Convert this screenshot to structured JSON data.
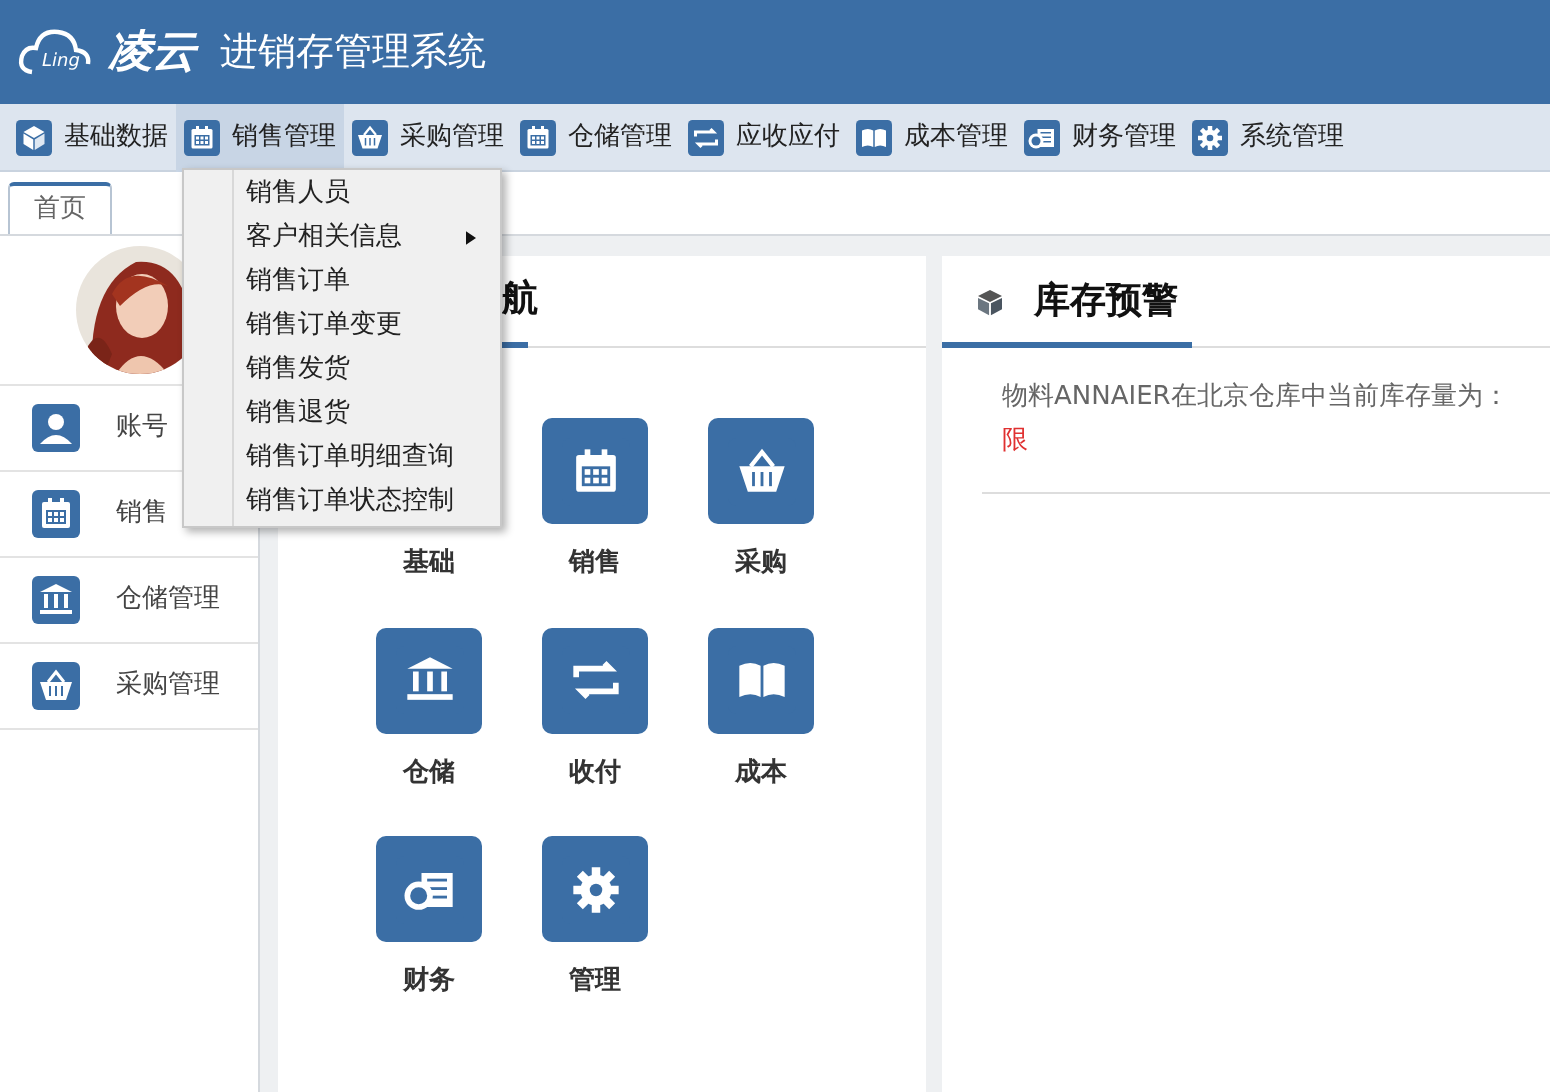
{
  "header": {
    "logo_text": "Ling",
    "brand": "凌云",
    "title": "进销存管理系统"
  },
  "nav": [
    {
      "label": "基础数据",
      "selected": false
    },
    {
      "label": "销售管理",
      "selected": true
    },
    {
      "label": "采购管理",
      "selected": false
    },
    {
      "label": "仓储管理",
      "selected": false
    },
    {
      "label": "应收应付",
      "selected": false
    },
    {
      "label": "成本管理",
      "selected": false
    },
    {
      "label": "财务管理",
      "selected": false
    },
    {
      "label": "系统管理",
      "selected": false
    }
  ],
  "tabs": [
    {
      "label": "首页",
      "selected": true
    }
  ],
  "dropdown": [
    {
      "label": "销售人员",
      "submenu": false
    },
    {
      "label": "客户相关信息",
      "submenu": true
    },
    {
      "label": "销售订单",
      "submenu": false
    },
    {
      "label": "销售订单变更",
      "submenu": false
    },
    {
      "label": "销售发货",
      "submenu": false
    },
    {
      "label": "销售退货",
      "submenu": false
    },
    {
      "label": "销售订单明细查询",
      "submenu": false
    },
    {
      "label": "销售订单状态控制",
      "submenu": false
    }
  ],
  "sidebar": {
    "items": [
      {
        "label": "账号"
      },
      {
        "label": "销售"
      },
      {
        "label": "仓储管理"
      },
      {
        "label": "采购管理"
      }
    ]
  },
  "nav_panel": {
    "title": "航",
    "tiles": [
      {
        "label": "基础"
      },
      {
        "label": "销售"
      },
      {
        "label": "采购"
      },
      {
        "label": "仓储"
      },
      {
        "label": "收付"
      },
      {
        "label": "成本"
      },
      {
        "label": "财务"
      },
      {
        "label": "管理"
      }
    ]
  },
  "stock_panel": {
    "title": "库存预警",
    "message": "物料ANNAIER在北京仓库中当前库存量为：",
    "message_tail": "限"
  }
}
